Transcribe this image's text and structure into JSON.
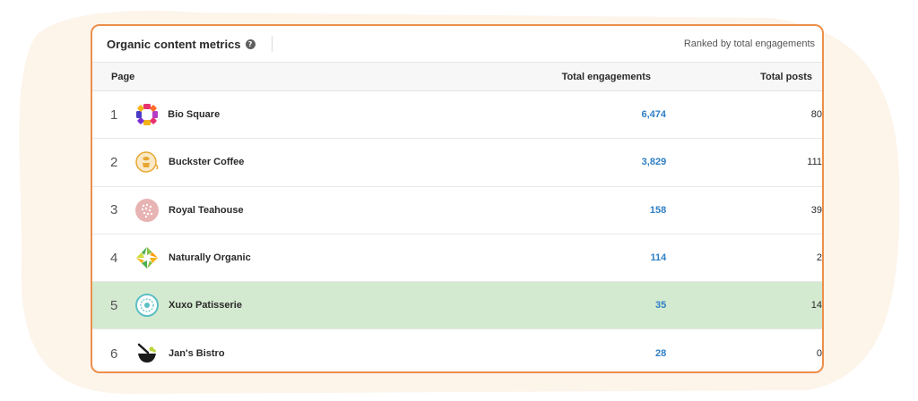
{
  "card": {
    "title": "Organic content metrics",
    "help_icon": "help-icon",
    "ranked_label": "Ranked by total engagements",
    "accent_color": "#ec8f4c"
  },
  "columns": {
    "page": "Page",
    "engagements": "Total engagements",
    "posts": "Total posts"
  },
  "rows": [
    {
      "rank": "1",
      "name": "Bio Square",
      "engagements": "6,474",
      "posts": "80",
      "logo": "bio-square-logo",
      "highlighted": false
    },
    {
      "rank": "2",
      "name": "Buckster Coffee",
      "engagements": "3,829",
      "posts": "111",
      "logo": "buckster-coffee-logo",
      "highlighted": false
    },
    {
      "rank": "3",
      "name": "Royal Teahouse",
      "engagements": "158",
      "posts": "39",
      "logo": "royal-teahouse-logo",
      "highlighted": false
    },
    {
      "rank": "4",
      "name": "Naturally Organic",
      "engagements": "114",
      "posts": "2",
      "logo": "naturally-organic-logo",
      "highlighted": false
    },
    {
      "rank": "5",
      "name": "Xuxo Patisserie",
      "engagements": "35",
      "posts": "14",
      "logo": "xuxo-patisserie-logo",
      "highlighted": true
    },
    {
      "rank": "6",
      "name": "Jan's Bistro",
      "engagements": "28",
      "posts": "0",
      "logo": "jans-bistro-logo",
      "highlighted": false
    }
  ],
  "colors": {
    "link_blue": "#2f7fc4",
    "highlight_green": "#d4ead0",
    "background_blob": "#fdf4ea"
  }
}
